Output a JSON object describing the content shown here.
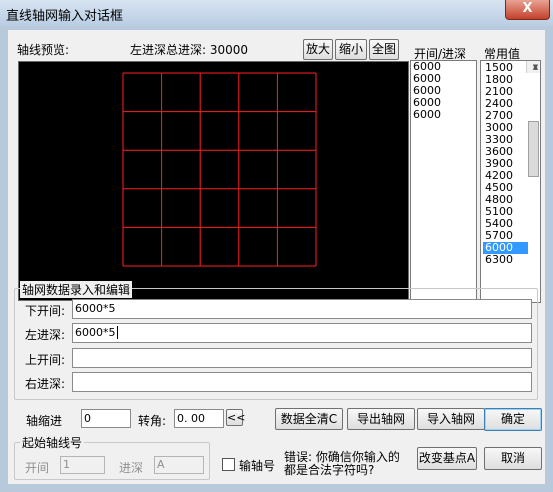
{
  "window": {
    "title": "直线轴网输入对话框",
    "close_glyph": "X"
  },
  "preview": {
    "label": "轴线预览:",
    "depth_summary": "左进深总进深: 30000",
    "zoom_in": "放大",
    "zoom_out": "缩小",
    "full_view": "全图",
    "grid_color": "#ff2020",
    "cols": 5,
    "rows": 5
  },
  "bay_list": {
    "header": "开间/进深",
    "items": [
      "6000",
      "6000",
      "6000",
      "6000",
      "6000"
    ]
  },
  "common_list": {
    "header": "常用值",
    "items": [
      "1500",
      "1800",
      "2100",
      "2400",
      "2700",
      "3000",
      "3300",
      "3600",
      "3900",
      "4200",
      "4500",
      "4800",
      "5100",
      "5400",
      "5700",
      "6000",
      "6300"
    ],
    "selected": "6000"
  },
  "edit_group": {
    "title": "轴网数据录入和编辑",
    "rows": [
      {
        "label": "下开间:",
        "value": "6000*5"
      },
      {
        "label": "左进深:",
        "value": "6000*5"
      },
      {
        "label": "上开间:",
        "value": ""
      },
      {
        "label": "右进深:",
        "value": ""
      }
    ]
  },
  "axis": {
    "shrink_label": "轴缩进",
    "shrink_value": "0",
    "angle_label": "转角:",
    "angle_value": "0. 00",
    "angle_button": "<<"
  },
  "actions": {
    "clear_all": "数据全清C",
    "export": "导出轴网",
    "import": "导入轴网",
    "confirm": "确定",
    "pick_point": "改变基点A",
    "cancel": "取消"
  },
  "start_axis": {
    "title": "起始轴线号",
    "bay_label": "开间",
    "bay_value": "1",
    "depth_label": "进深",
    "depth_value": "A",
    "output_label": "输轴号",
    "output_checked": false
  },
  "error": {
    "line1": "错误: 你确信你输入的",
    "line2": "都是合法字符吗?"
  }
}
